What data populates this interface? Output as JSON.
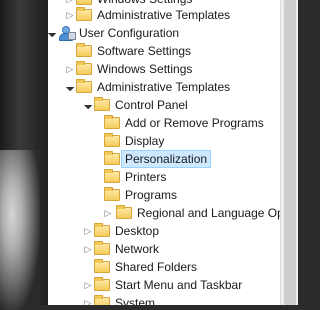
{
  "tree": {
    "items": [
      {
        "label": "Windows Settings",
        "twisty": "collapsed",
        "icon": "folder-icon"
      },
      {
        "label": "Administrative Templates",
        "twisty": "collapsed",
        "icon": "folder-icon"
      },
      {
        "label": "User Configuration",
        "twisty": "expanded",
        "icon": "user-config-icon"
      },
      {
        "label": "Software Settings",
        "twisty": "collapsed",
        "icon": "folder-icon"
      },
      {
        "label": "Windows Settings",
        "twisty": "collapsed",
        "icon": "folder-icon"
      },
      {
        "label": "Administrative Templates",
        "twisty": "expanded",
        "icon": "folder-icon"
      },
      {
        "label": "Control Panel",
        "twisty": "expanded",
        "icon": "folder-icon"
      },
      {
        "label": "Add or Remove Programs",
        "twisty": "none",
        "icon": "folder-icon"
      },
      {
        "label": "Display",
        "twisty": "none",
        "icon": "folder-icon"
      },
      {
        "label": "Personalization",
        "twisty": "none",
        "icon": "folder-icon",
        "selected": true
      },
      {
        "label": "Printers",
        "twisty": "none",
        "icon": "folder-icon"
      },
      {
        "label": "Programs",
        "twisty": "none",
        "icon": "folder-icon"
      },
      {
        "label": "Regional and Language Options",
        "twisty": "collapsed",
        "icon": "folder-icon"
      },
      {
        "label": "Desktop",
        "twisty": "collapsed",
        "icon": "folder-icon"
      },
      {
        "label": "Network",
        "twisty": "collapsed",
        "icon": "folder-icon"
      },
      {
        "label": "Shared Folders",
        "twisty": "none",
        "icon": "folder-icon"
      },
      {
        "label": "Start Menu and Taskbar",
        "twisty": "collapsed",
        "icon": "folder-icon"
      },
      {
        "label": "System",
        "twisty": "collapsed",
        "icon": "folder-icon"
      }
    ]
  },
  "colors": {
    "selection_bg": "#cde8ff",
    "selection_border": "#99d1ff",
    "folder": "#f5cc5a"
  }
}
